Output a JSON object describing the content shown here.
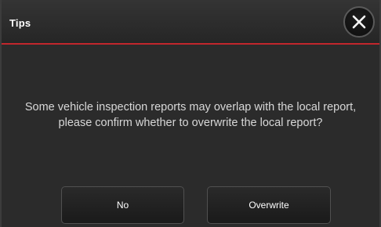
{
  "dialog": {
    "title": "Tips",
    "close_icon": "close-icon",
    "message": "Some vehicle inspection reports may overlap with the local report, please confirm whether to overwrite the local report?",
    "buttons": {
      "no_label": "No",
      "overwrite_label": "Overwrite"
    }
  },
  "colors": {
    "accent_line": "#c2262c",
    "background": "#2b2b2b",
    "text": "#d8d8d8"
  }
}
